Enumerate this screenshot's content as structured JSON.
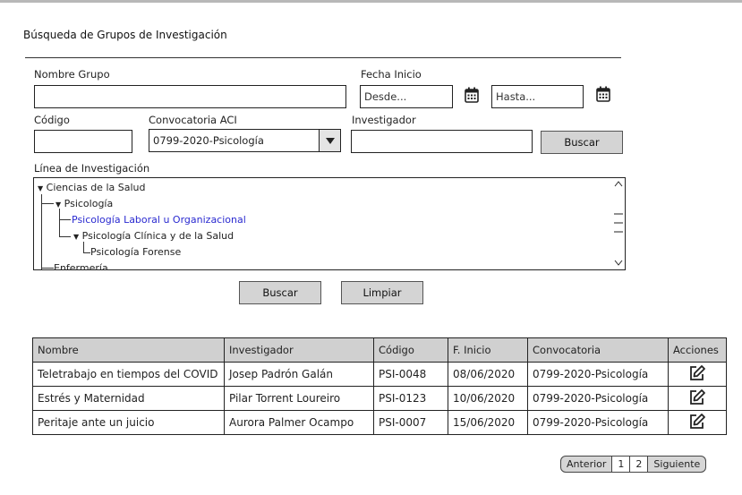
{
  "header": {
    "title": "Búsqueda de Grupos de Investigación"
  },
  "form": {
    "nombre_label": "Nombre Grupo",
    "fecha_label": "Fecha Inicio",
    "desde_placeholder": "Desde...",
    "hasta_placeholder": "Hasta...",
    "codigo_label": "Código",
    "convocatoria_label": "Convocatoria ACI",
    "convocatoria_value": "0799-2020-Psicología",
    "investigador_label": "Investigador",
    "investigador_search_label": "Buscar",
    "linea_label": "Línea de Investigación"
  },
  "tree": {
    "items": [
      {
        "label": "Ciencias de la Salud",
        "expanded": true
      },
      {
        "label": "Psicología",
        "expanded": true
      },
      {
        "label": "Psicología Laboral u Organizacional",
        "selected": true
      },
      {
        "label": "Psicología Clínica y de la Salud",
        "expanded": true
      },
      {
        "label": "Psicología Forense"
      },
      {
        "label": "Enfermería"
      }
    ]
  },
  "actions": {
    "search_label": "Buscar",
    "clear_label": "Limpiar"
  },
  "table": {
    "columns": [
      "Nombre",
      "Investigador",
      "Código",
      "F. Inicio",
      "Convocatoria",
      "Acciones"
    ],
    "rows": [
      [
        "Teletrabajo en tiempos del COVID",
        "Josep Padrón Galán",
        "PSI-0048",
        "08/06/2020",
        "0799-2020-Psicología"
      ],
      [
        "Estrés y Maternidad",
        "Pilar Torrent Loureiro",
        "PSI-0123",
        "10/06/2020",
        "0799-2020-Psicología"
      ],
      [
        "Peritaje ante un juicio",
        "Aurora Palmer Ocampo",
        "PSI-0007",
        "15/06/2020",
        "0799-2020-Psicología"
      ]
    ],
    "row_action_icon": "edit-icon"
  },
  "pagination": {
    "prev_label": "Anterior",
    "pages": [
      "1",
      "2"
    ],
    "next_label": "Siguiente"
  }
}
